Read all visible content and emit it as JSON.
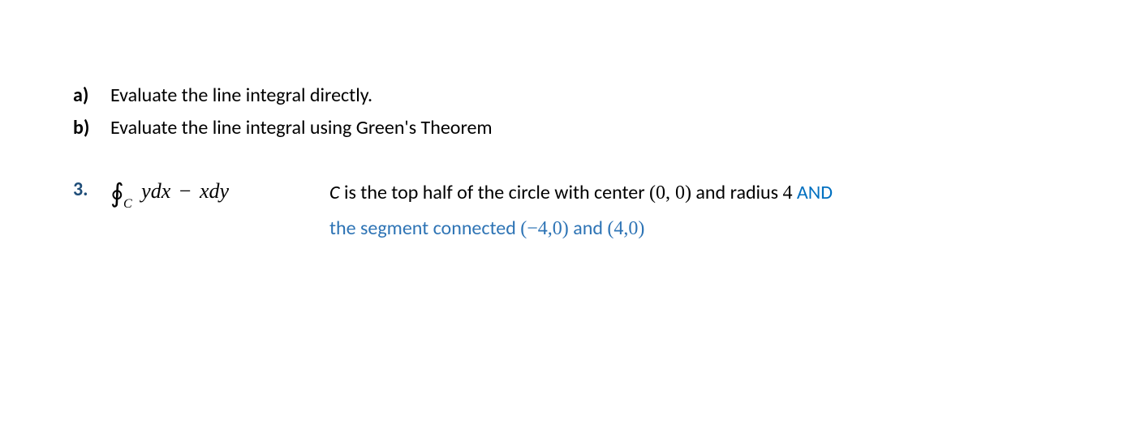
{
  "items": {
    "a": {
      "marker": "a)",
      "text": "Evaluate the line integral directly."
    },
    "b": {
      "marker": "b)",
      "text": "Evaluate the line integral using Green's Theorem"
    }
  },
  "problem": {
    "number": "3.",
    "integral": {
      "symbol": "∮",
      "subscript": "C",
      "term1": "ydx",
      "minus": "−",
      "term2": "xdy"
    },
    "description": {
      "c_var": "C",
      "line1_part1": " is the top half of the circle with center ",
      "line1_center": "(0, 0)",
      "line1_part2": " and radius ",
      "line1_radius": "4",
      "line1_and": " AND",
      "line2_pre": "the segment connected ",
      "line2_pt1": "(−4,0)",
      "line2_mid": " and ",
      "line2_pt2": "(4,0)"
    }
  }
}
